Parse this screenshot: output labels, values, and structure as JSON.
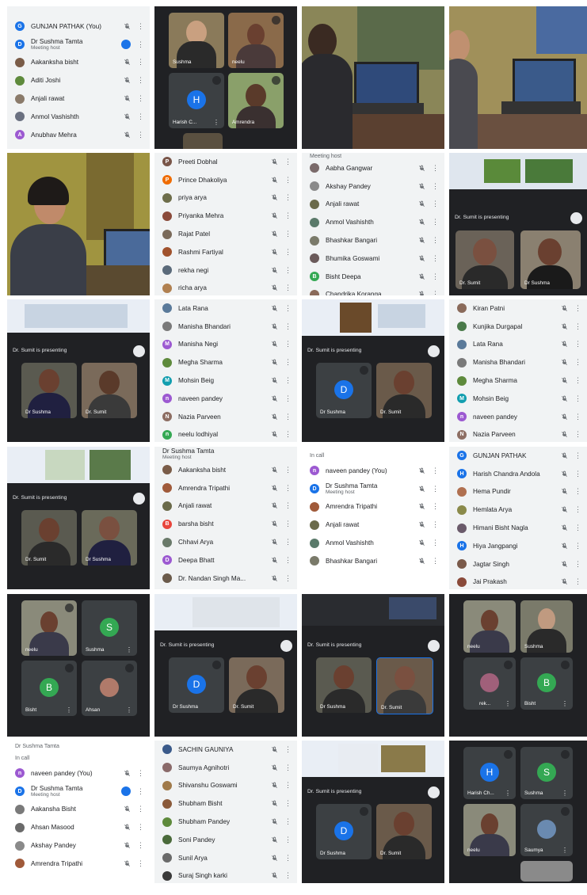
{
  "colors": {
    "panel": "#f1f3f4",
    "dark": "#202124",
    "tile": "#3c4043",
    "blue": "#1a73e8",
    "green": "#34a853"
  },
  "icons": {
    "mic_off": "mic-off-icon",
    "more": "more-vert-icon",
    "fullscreen": "fullscreen-icon",
    "host": "more-horiz-icon"
  },
  "more_glyph": "⋮",
  "lists": {
    "p1": {
      "rows": [
        {
          "name": "GUNJAN PATHAK (You)",
          "init": "G",
          "color": "#1a73e8",
          "sub": ""
        },
        {
          "name": "Dr Sushma Tamta",
          "init": "D",
          "color": "#1a73e8",
          "sub": "Meeting host",
          "host": true
        },
        {
          "name": "Aakanksha bisht",
          "init": "",
          "color": "#7a5c48",
          "sub": ""
        },
        {
          "name": "Aditi Joshi",
          "init": "",
          "color": "#5e8a3c",
          "sub": ""
        },
        {
          "name": "Anjali rawat",
          "init": "",
          "color": "#8a7a6a",
          "sub": ""
        },
        {
          "name": "Anmol Vashishth",
          "init": "",
          "color": "#6a7080",
          "sub": ""
        },
        {
          "name": "Anubhav Mehra",
          "init": "A",
          "color": "#9c59d1",
          "sub": ""
        }
      ]
    },
    "p6": {
      "rows": [
        {
          "name": "Preeti Dobhal",
          "init": "P",
          "color": "#795548"
        },
        {
          "name": "Prince Dhakoliya",
          "init": "P",
          "color": "#ef6c00"
        },
        {
          "name": "priya arya",
          "init": "",
          "color": "#6d6d4a"
        },
        {
          "name": "Priyanka Mehra",
          "init": "",
          "color": "#8a4a3a"
        },
        {
          "name": "Rajat Patel",
          "init": "",
          "color": "#7a6a5a"
        },
        {
          "name": "Rashmi Fartiyal",
          "init": "",
          "color": "#a0522d"
        },
        {
          "name": "rekha negi",
          "init": "",
          "color": "#5a6a7a"
        },
        {
          "name": "richa arya",
          "init": "",
          "color": "#b08050"
        }
      ]
    },
    "p7": {
      "header": "Meeting host",
      "rows": [
        {
          "name": "Aabha Gangwar",
          "init": "",
          "color": "#7a6a6a"
        },
        {
          "name": "Akshay Pandey",
          "init": "",
          "color": "#8a8a8a"
        },
        {
          "name": "Anjali rawat",
          "init": "",
          "color": "#6a6a4a"
        },
        {
          "name": "Anmol Vashishth",
          "init": "",
          "color": "#5a7a6a"
        },
        {
          "name": "Bhashkar Bangari",
          "init": "",
          "color": "#7a7a6a"
        },
        {
          "name": "Bhumika Goswami",
          "init": "",
          "color": "#6a5a5a"
        },
        {
          "name": "Bisht Deepa",
          "init": "B",
          "color": "#34a853"
        },
        {
          "name": "Chandrika Koranga",
          "init": "",
          "color": "#8a6a5a"
        }
      ]
    },
    "p10": {
      "rows": [
        {
          "name": "Lata Rana",
          "init": "",
          "color": "#5a7a9a"
        },
        {
          "name": "Manisha Bhandari",
          "init": "",
          "color": "#7a7a7a"
        },
        {
          "name": "Manisha Negi",
          "init": "M",
          "color": "#9c59d1"
        },
        {
          "name": "Megha Sharma",
          "init": "",
          "color": "#5e8a3c"
        },
        {
          "name": "Mohsin Beig",
          "init": "M",
          "color": "#129eaf"
        },
        {
          "name": "naveen pandey",
          "init": "n",
          "color": "#9c59d1"
        },
        {
          "name": "Nazia Parveen",
          "init": "N",
          "color": "#8d6e63"
        },
        {
          "name": "neelu lodhiyal",
          "init": "n",
          "color": "#34a853"
        }
      ]
    },
    "p12": {
      "rows": [
        {
          "name": "Kiran Patni",
          "init": "",
          "color": "#8a6a5a"
        },
        {
          "name": "Kunjika Durgapal",
          "init": "",
          "color": "#4a7a4a"
        },
        {
          "name": "Lata Rana",
          "init": "",
          "color": "#5a7a9a"
        },
        {
          "name": "Manisha Bhandari",
          "init": "",
          "color": "#7a7a7a"
        },
        {
          "name": "Megha Sharma",
          "init": "",
          "color": "#5e8a3c"
        },
        {
          "name": "Mohsin Beig",
          "init": "M",
          "color": "#129eaf"
        },
        {
          "name": "naveen pandey",
          "init": "n",
          "color": "#9c59d1"
        },
        {
          "name": "Nazia Parveen",
          "init": "N",
          "color": "#8d6e63"
        }
      ]
    },
    "p14": {
      "header": "Dr Sushma Tamta",
      "header_sub": "Meeting host",
      "rows": [
        {
          "name": "Aakanksha bisht",
          "init": "",
          "color": "#7a5c48"
        },
        {
          "name": "Amrendra Tripathi",
          "init": "",
          "color": "#a05a3a"
        },
        {
          "name": "Anjali rawat",
          "init": "",
          "color": "#6a6a4a"
        },
        {
          "name": "barsha bisht",
          "init": "B",
          "color": "#e8453c"
        },
        {
          "name": "Chhavi Arya",
          "init": "",
          "color": "#6a7a6a"
        },
        {
          "name": "Deepa Bhatt",
          "init": "D",
          "color": "#9c59d1"
        },
        {
          "name": "Dr. Nandan Singh Ma...",
          "init": "",
          "color": "#6a5a4a"
        }
      ]
    },
    "p15": {
      "section": "In call",
      "rows": [
        {
          "name": "naveen pandey (You)",
          "init": "n",
          "color": "#9c59d1",
          "sub": ""
        },
        {
          "name": "Dr Sushma Tamta",
          "init": "D",
          "color": "#1a73e8",
          "sub": "Meeting host"
        },
        {
          "name": "Amrendra Tripathi",
          "init": "",
          "color": "#a05a3a",
          "sub": ""
        },
        {
          "name": "Anjali rawat",
          "init": "",
          "color": "#6a6a4a",
          "sub": ""
        },
        {
          "name": "Anmol Vashishth",
          "init": "",
          "color": "#5a7a6a",
          "sub": ""
        },
        {
          "name": "Bhashkar Bangari",
          "init": "",
          "color": "#7a7a6a",
          "sub": ""
        }
      ]
    },
    "p16": {
      "rows": [
        {
          "name": "GUNJAN PATHAK",
          "init": "G",
          "color": "#1a73e8"
        },
        {
          "name": "Harish Chandra Andola",
          "init": "H",
          "color": "#1a73e8"
        },
        {
          "name": "Hema Pundir",
          "init": "",
          "color": "#b07050"
        },
        {
          "name": "Hemlata Arya",
          "init": "",
          "color": "#8a8a4a"
        },
        {
          "name": "Himani Bisht Nagla",
          "init": "",
          "color": "#6a5a6a"
        },
        {
          "name": "Hiya Jangpangi",
          "init": "H",
          "color": "#1a73e8"
        },
        {
          "name": "Jagtar Singh",
          "init": "",
          "color": "#7a5a4a"
        },
        {
          "name": "Jai Prakash",
          "init": "",
          "color": "#8a4a3a"
        }
      ]
    },
    "p21": {
      "top": "Dr Sushma Tamta",
      "section": "In call",
      "rows": [
        {
          "name": "naveen pandey (You)",
          "init": "n",
          "color": "#9c59d1",
          "sub": ""
        },
        {
          "name": "Dr Sushma Tamta",
          "init": "D",
          "color": "#1a73e8",
          "sub": "Meeting host",
          "host": true
        },
        {
          "name": "Aakansha Bisht",
          "init": "",
          "color": "#7a7a7a",
          "sub": ""
        },
        {
          "name": "Ahsan Masood",
          "init": "",
          "color": "#6a6a6a",
          "sub": ""
        },
        {
          "name": "Akshay Pandey",
          "init": "",
          "color": "#8a8a8a",
          "sub": ""
        },
        {
          "name": "Amrendra Tripathi",
          "init": "",
          "color": "#a05a3a",
          "sub": ""
        }
      ]
    },
    "p22": {
      "rows": [
        {
          "name": "SACHIN GAUNIYA",
          "init": "",
          "color": "#3a5a8a"
        },
        {
          "name": "Saumya Agnihotri",
          "init": "",
          "color": "#8a6a6a"
        },
        {
          "name": "Shivanshu Goswami",
          "init": "",
          "color": "#a07a4a"
        },
        {
          "name": "Shubham Bisht",
          "init": "",
          "color": "#8a5a3a"
        },
        {
          "name": "Shubham Pandey",
          "init": "",
          "color": "#5e8a3c"
        },
        {
          "name": "Soni Pandey",
          "init": "",
          "color": "#4a6a3a"
        },
        {
          "name": "Sunil Arya",
          "init": "",
          "color": "#6a6a6a"
        },
        {
          "name": "Suraj Singh karki",
          "init": "",
          "color": "#3a3a3a"
        }
      ]
    }
  },
  "video": {
    "p2": {
      "tiles": [
        "Sushma",
        "neelu",
        "Harish C...",
        "Amrendra"
      ],
      "h_init": "H"
    },
    "p8": {
      "presenting": "Dr. Sumit is presenting",
      "tiles": [
        "Dr. Sumit",
        "Dr Sushma"
      ]
    },
    "p9": {
      "presenting": "Dr. Sumit is presenting",
      "tiles": [
        "Dr Sushma",
        "Dr. Sumit"
      ]
    },
    "p11": {
      "presenting": "Dr. Sumit is presenting",
      "tiles": [
        "Dr Sushma",
        "Dr. Sumit"
      ],
      "d_init": "D"
    },
    "p13": {
      "presenting": "Dr. Sumit is presenting",
      "tiles": [
        "Dr. Sumit",
        "Dr Sushma"
      ]
    },
    "p17": {
      "tiles": [
        "neelu",
        "Sushma",
        "Bisht",
        "Ahsan"
      ],
      "s_init": "S",
      "b_init": "B"
    },
    "p18": {
      "presenting": "Dr. Sumit is presenting",
      "tiles": [
        "Dr Sushma",
        "Dr. Sumit"
      ],
      "d_init": "D"
    },
    "p19": {
      "presenting": "Dr. Sumit is presenting",
      "tiles": [
        "Dr Sushma",
        "Dr. Sumit"
      ]
    },
    "p20": {
      "tiles": [
        "neelu",
        "Sushma",
        "rek...",
        "Bisht"
      ],
      "b_init": "B"
    },
    "p23": {
      "presenting": "Dr. Sumit is presenting",
      "tiles": [
        "Dr Sushma",
        "Dr. Sumit"
      ],
      "d_init": "D"
    },
    "p24": {
      "tiles": [
        "Harish Ch...",
        "Sushma",
        "neelu",
        "Saumya"
      ],
      "h_init": "H",
      "s_init": "S"
    }
  }
}
